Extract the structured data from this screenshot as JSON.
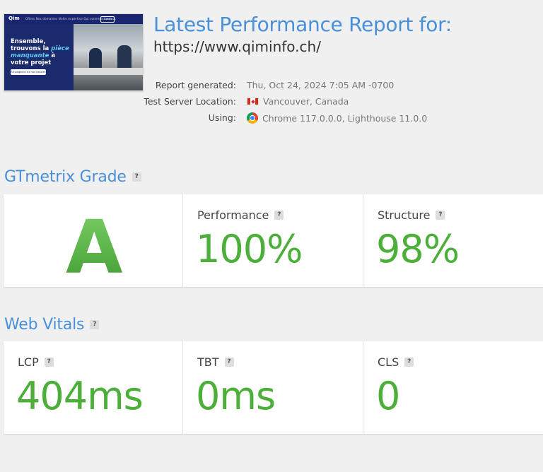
{
  "header": {
    "title": "Latest Performance Report for:",
    "url": "https://www.qiminfo.ch/"
  },
  "thumbnail": {
    "logo": "Qim",
    "nav_links": "Offres   Nos domaines   Notre expertise   Qui sommes   Contact",
    "nav_button": "Contact",
    "headline_1": "Ensemble, trouvons la",
    "headline_em": "pièce manquante",
    "headline_2": "à votre projet",
    "cta": "Échangeons sur vos besoins"
  },
  "meta": {
    "report_generated_label": "Report generated:",
    "report_generated_value": "Thu, Oct 24, 2024 7:05 AM -0700",
    "server_label": "Test Server Location:",
    "server_value": "Vancouver, Canada",
    "server_icon": "canada-flag-icon",
    "using_label": "Using:",
    "using_value": "Chrome 117.0.0.0, Lighthouse 11.0.0",
    "using_icon": "chrome-icon"
  },
  "grade": {
    "title": "GTmetrix Grade",
    "help": "?",
    "letter": "A",
    "performance_label": "Performance",
    "performance_value": "100%",
    "structure_label": "Structure",
    "structure_value": "98%"
  },
  "vitals": {
    "title": "Web Vitals",
    "help": "?",
    "lcp_label": "LCP",
    "lcp_value": "404ms",
    "tbt_label": "TBT",
    "tbt_value": "0ms",
    "cls_label": "CLS",
    "cls_value": "0"
  },
  "colors": {
    "accent_blue": "#4a90d9",
    "good_green": "#4caf3a",
    "panel_bg": "#ffffff",
    "page_bg": "#f0f0f0"
  }
}
